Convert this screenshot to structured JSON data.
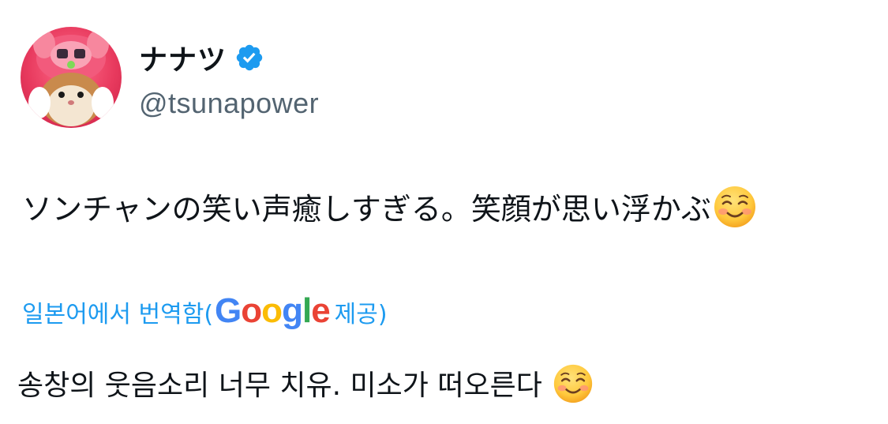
{
  "author": {
    "display_name": "ナナツ",
    "handle": "@tsunapower",
    "verified": true,
    "verified_color": "#1d9bf0"
  },
  "tweet": {
    "text": "ソンチャンの笑い声癒しすぎる。笑顔が思い浮かぶ",
    "emoji": "smiling-face-icon"
  },
  "translation": {
    "prefix": "일본어에서 번역함(",
    "provider_letters": [
      "G",
      "o",
      "o",
      "g",
      "l",
      "e"
    ],
    "suffix": " 제공)",
    "link_color": "#1d9bf0",
    "text": "송창의 웃음소리 너무 치유. 미소가 떠오른다 ",
    "emoji": "smiling-face-icon"
  }
}
